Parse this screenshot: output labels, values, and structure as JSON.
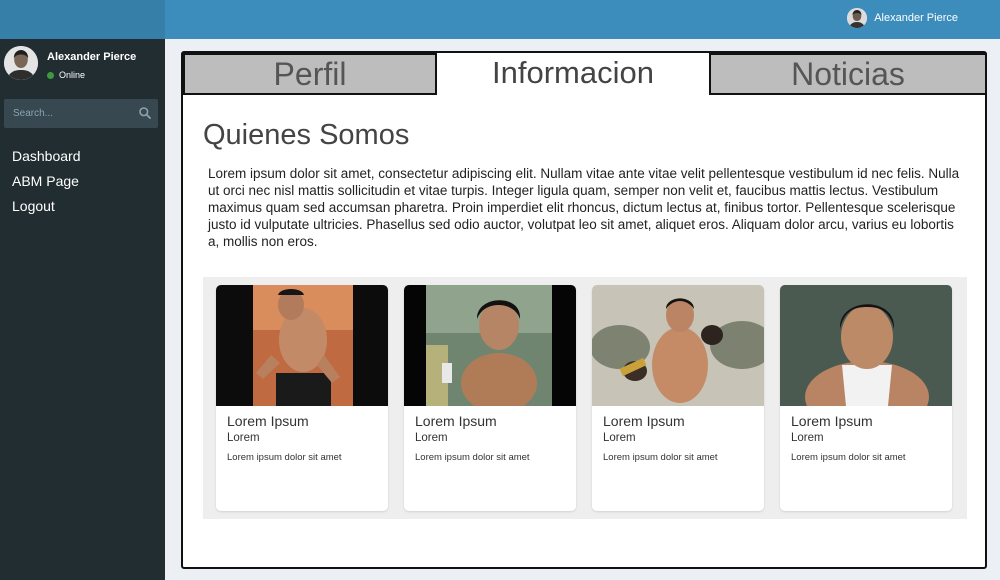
{
  "header": {
    "user_name": "Alexander Pierce"
  },
  "sidebar": {
    "user_name": "Alexander Pierce",
    "status": "Online",
    "search_placeholder": "Search...",
    "nav": [
      {
        "label": "Dashboard"
      },
      {
        "label": "ABM Page"
      },
      {
        "label": "Logout"
      }
    ]
  },
  "tabs": [
    {
      "label": "Perfil",
      "active": false
    },
    {
      "label": "Informacion",
      "active": true
    },
    {
      "label": "Noticias",
      "active": false
    }
  ],
  "content": {
    "title": "Quienes Somos",
    "paragraph": "Lorem ipsum dolor sit amet, consectetur adipiscing elit. Nullam vitae ante vitae velit pellentesque vestibulum id nec felis. Nulla ut orci nec nisl mattis sollicitudin et vitae turpis. Integer ligula quam, semper non velit et, faucibus mattis lectus. Vestibulum maximus quam sed accumsan pharetra. Proin imperdiet elit rhoncus, dictum lectus at, finibus tortor. Pellentesque scelerisque justo id vulputate ultricies. Phasellus sed odio auctor, volutpat leo sit amet, aliquet eros. Aliquam dolor arcu, varius eu lobortis a, mollis non eros.",
    "cards": [
      {
        "title": "Lorem Ipsum",
        "subtitle": "Lorem",
        "text": "Lorem ipsum dolor sit amet"
      },
      {
        "title": "Lorem Ipsum",
        "subtitle": "Lorem",
        "text": "Lorem ipsum dolor sit amet"
      },
      {
        "title": "Lorem Ipsum",
        "subtitle": "Lorem",
        "text": "Lorem ipsum dolor sit amet"
      },
      {
        "title": "Lorem Ipsum",
        "subtitle": "Lorem",
        "text": "Lorem ipsum dolor sit amet"
      }
    ]
  },
  "colors": {
    "topbar": "#3c8dbc",
    "sidebar": "#222d32",
    "status_online": "#3c9a3c",
    "tab_inactive": "#bdbdbd"
  }
}
